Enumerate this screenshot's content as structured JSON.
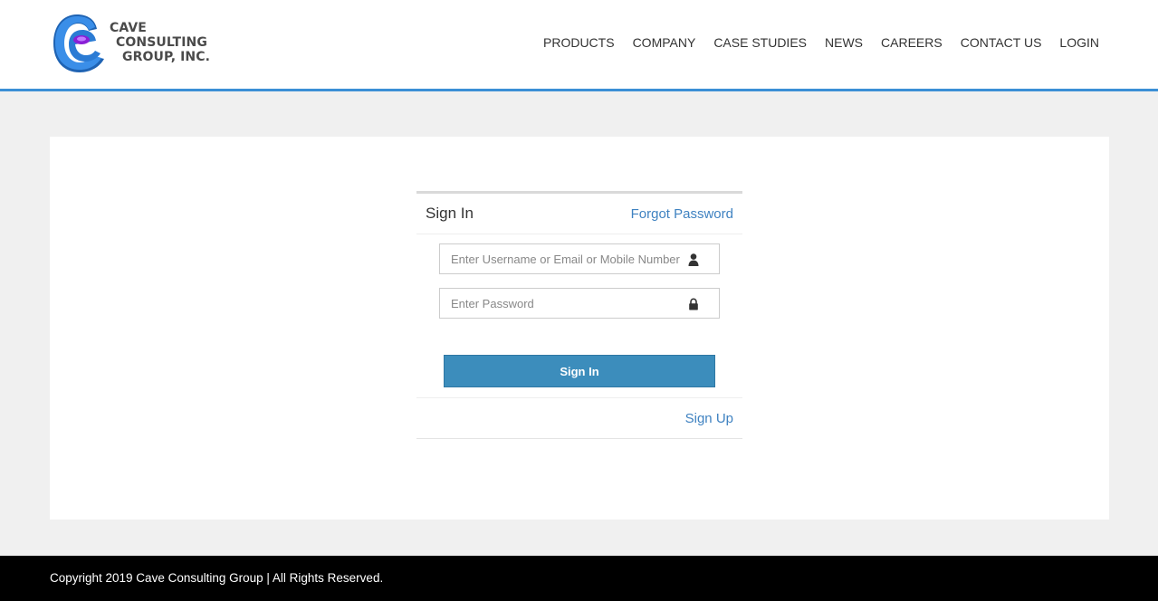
{
  "header": {
    "logo": {
      "line1": "CAVE",
      "line2": "CONSULTING",
      "line3": "GROUP, INC."
    },
    "nav": [
      "PRODUCTS",
      "COMPANY",
      "CASE STUDIES",
      "NEWS",
      "CAREERS",
      "CONTACT US",
      "LOGIN"
    ]
  },
  "login": {
    "title": "Sign In",
    "forgot_label": "Forgot Password",
    "username_placeholder": "Enter Username or Email or Mobile Number",
    "username_icon": "user-icon",
    "password_placeholder": "Enter Password",
    "password_icon": "lock-icon",
    "submit_label": "Sign In",
    "signup_label": "Sign Up"
  },
  "footer": {
    "copyright": "Copyright 2019 Cave Consulting Group | All Rights Reserved."
  },
  "colors": {
    "accent": "#3b8fd6",
    "button": "#3c8dbc",
    "link": "#3f82c1",
    "page_bg": "#f0f0f0",
    "footer_bg": "#000000"
  }
}
